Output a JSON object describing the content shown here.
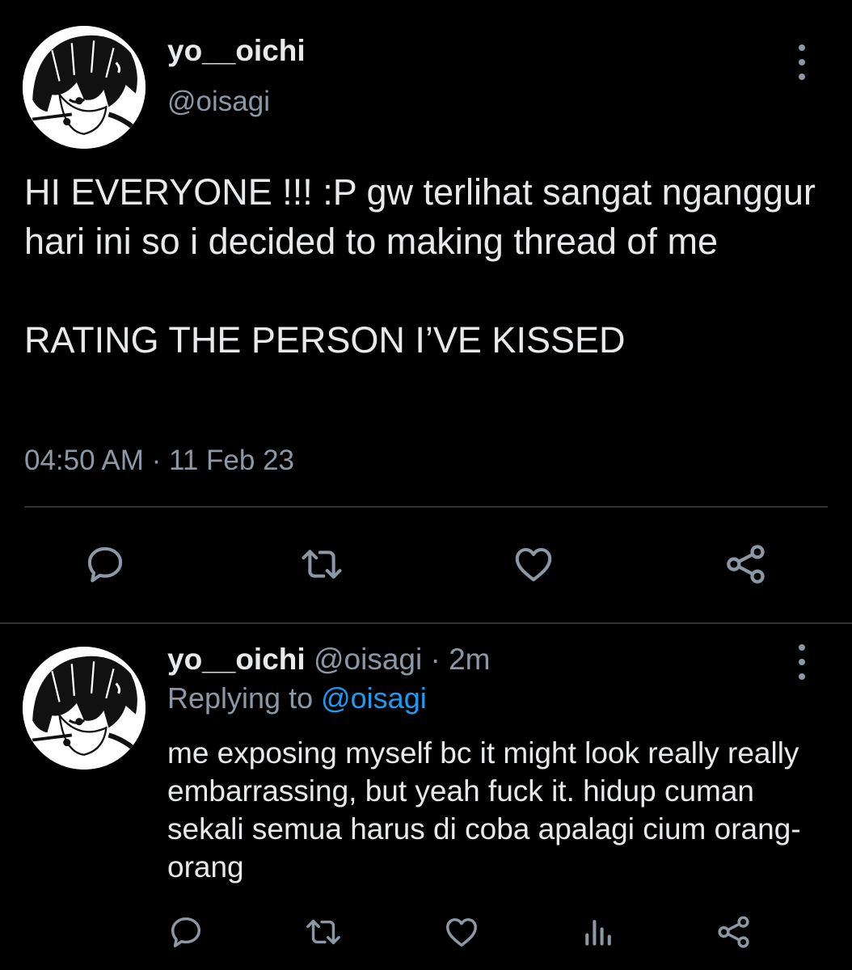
{
  "colors": {
    "background": "#000000",
    "text": "#e7e9ea",
    "secondary": "#8b98a5",
    "link": "#1d9bf0",
    "divider": "#2f3336"
  },
  "main_tweet": {
    "display_name": "yo__oichi",
    "handle": "@oisagi",
    "text": "HI EVERYONE !!! :P gw terlihat sangat nganggur hari ini so i decided to making thread of me\n\nRATING THE PERSON I’VE KISSED",
    "timestamp": "04:50 AM · 11 Feb 23",
    "avatar_icon": "manga-avatar",
    "more_icon": "more-vertical-icon",
    "actions": [
      {
        "name": "reply",
        "icon": "reply-icon"
      },
      {
        "name": "retweet",
        "icon": "retweet-icon"
      },
      {
        "name": "like",
        "icon": "like-icon"
      },
      {
        "name": "share",
        "icon": "share-icon"
      }
    ]
  },
  "reply_tweet": {
    "display_name": "yo__oichi",
    "meta": " @oisagi · 2m",
    "replying_prefix": "Replying to ",
    "replying_mention": "@oisagi",
    "text": "me exposing myself bc it might look really really embarrassing, but yeah fuck it. hidup cuman sekali semua harus di coba apalagi cium orang-orang",
    "avatar_icon": "manga-avatar",
    "more_icon": "more-vertical-icon",
    "actions": [
      {
        "name": "reply",
        "icon": "reply-icon"
      },
      {
        "name": "retweet",
        "icon": "retweet-icon"
      },
      {
        "name": "like",
        "icon": "like-icon"
      },
      {
        "name": "analytics",
        "icon": "analytics-icon"
      },
      {
        "name": "share",
        "icon": "share-icon"
      }
    ]
  }
}
